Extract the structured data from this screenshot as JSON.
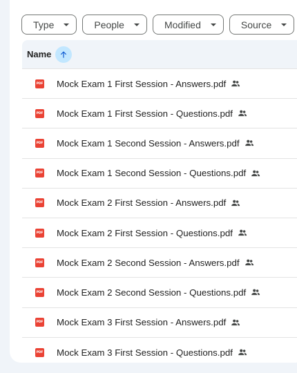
{
  "filters": [
    {
      "label": "Type"
    },
    {
      "label": "People"
    },
    {
      "label": "Modified"
    },
    {
      "label": "Source"
    }
  ],
  "table": {
    "header": {
      "name_label": "Name",
      "sort": "ascending"
    },
    "pdf_badge": "PDF",
    "rows": [
      {
        "name": "Mock Exam 1 First Session - Answers.pdf",
        "shared": true
      },
      {
        "name": "Mock Exam 1 First Session - Questions.pdf",
        "shared": true
      },
      {
        "name": "Mock Exam 1 Second Session - Answers.pdf",
        "shared": true
      },
      {
        "name": "Mock Exam 1 Second Session - Questions.pdf",
        "shared": true
      },
      {
        "name": "Mock Exam 2 First Session - Answers.pdf",
        "shared": true
      },
      {
        "name": "Mock Exam 2 First Session - Questions.pdf",
        "shared": true
      },
      {
        "name": "Mock Exam 2 Second Session - Answers.pdf",
        "shared": true
      },
      {
        "name": "Mock Exam 2 Second Session - Questions.pdf",
        "shared": true
      },
      {
        "name": "Mock Exam 3 First Session - Answers.pdf",
        "shared": true
      },
      {
        "name": "Mock Exam 3 First Session - Questions.pdf",
        "shared": true
      }
    ]
  },
  "colors": {
    "pdf_red": "#ea4335",
    "sort_button_bg": "#c2e7ff",
    "sort_arrow": "#0b57d0",
    "header_bg": "#f0f4f9"
  }
}
